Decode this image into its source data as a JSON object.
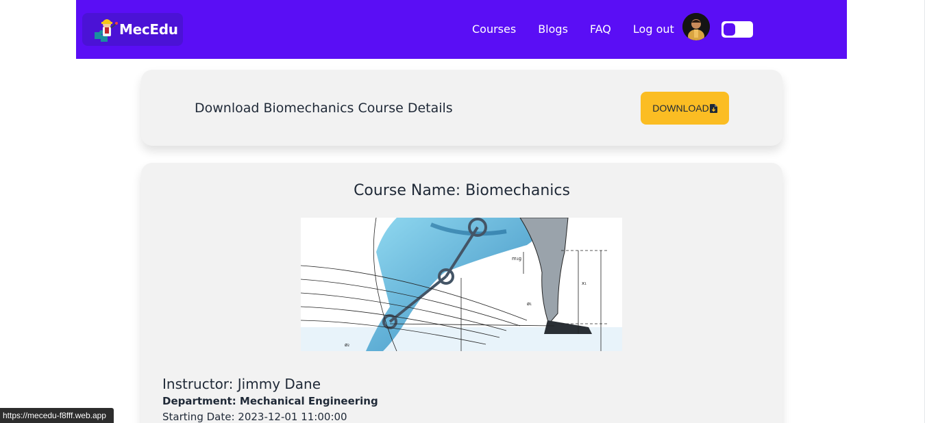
{
  "brand": {
    "name": "MecEdu"
  },
  "nav": {
    "links": [
      "Courses",
      "Blogs",
      "FAQ",
      "Log out"
    ]
  },
  "download_section": {
    "title": "Download Biomechanics Course Details",
    "button_label": "DOWNLOAD"
  },
  "course": {
    "title": "Course Name: Biomechanics",
    "instructor": "Instructor: Jimmy Dane",
    "department": "Department: Mechanical Engineering",
    "starting_date": "Starting Date: 2023-12-01 11:00:00"
  },
  "status_bar": {
    "url": "https://mecedu-f8fff.web.app"
  },
  "colors": {
    "nav_bg": "#5a0ef5",
    "brand_bg": "#4b12d6",
    "download_button": "#fbbd23",
    "card_bg": "#f2f2f2"
  },
  "icons": {
    "brand": "engineer-puzzle-logo",
    "download": "file-download-icon"
  }
}
